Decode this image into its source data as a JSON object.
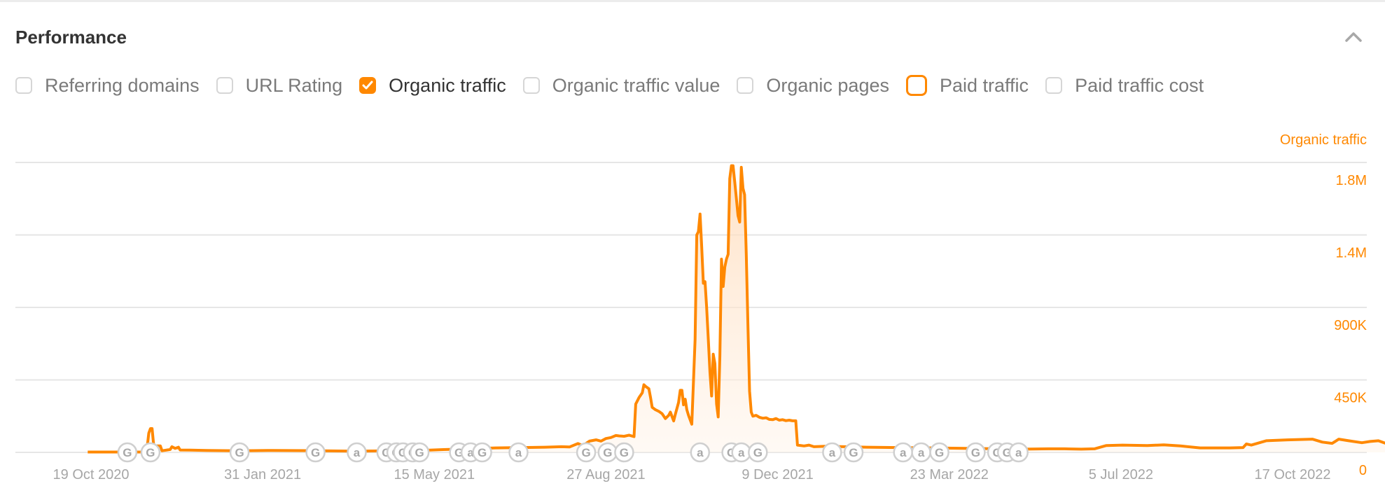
{
  "section": {
    "title": "Performance",
    "collapse_icon": "chevron-up-icon"
  },
  "metrics": [
    {
      "label": "Referring domains",
      "state": "unchecked"
    },
    {
      "label": "URL Rating",
      "state": "unchecked"
    },
    {
      "label": "Organic traffic",
      "state": "checked"
    },
    {
      "label": "Organic traffic value",
      "state": "unchecked"
    },
    {
      "label": "Organic pages",
      "state": "unchecked"
    },
    {
      "label": "Paid traffic",
      "state": "highlighted"
    },
    {
      "label": "Paid traffic cost",
      "state": "unchecked"
    }
  ],
  "colors": {
    "accent": "#ff8800",
    "area_fill": "#ffe7d1",
    "grid": "#e6e6e6",
    "muted_text": "#a6a6a6"
  },
  "chart_data": {
    "type": "area",
    "title": "",
    "series_name": "Organic traffic",
    "ylabel": "Organic traffic",
    "ylim": [
      0,
      1800000
    ],
    "yticks": [
      {
        "value": 1800000,
        "label": "1.8M"
      },
      {
        "value": 1350000,
        "label": "1.4M"
      },
      {
        "value": 900000,
        "label": "900K"
      },
      {
        "value": 450000,
        "label": "450K"
      },
      {
        "value": 0,
        "label": "0"
      }
    ],
    "x_start_date": "2020-10-19",
    "xlim_days": [
      -31,
      781
    ],
    "xticks": [
      {
        "day": 0,
        "label": "19 Oct 2020"
      },
      {
        "day": 104,
        "label": "31 Jan 2021"
      },
      {
        "day": 208,
        "label": "15 May 2021"
      },
      {
        "day": 312,
        "label": "27 Aug 2021"
      },
      {
        "day": 416,
        "label": "9 Dec 2021"
      },
      {
        "day": 520,
        "label": "23 Mar 2022"
      },
      {
        "day": 624,
        "label": "5 Jul 2022"
      },
      {
        "day": 728,
        "label": "17 Oct 2022"
      }
    ],
    "grid": true,
    "points_day_value": [
      [
        -2,
        2000
      ],
      [
        20,
        2000
      ],
      [
        30,
        2000
      ],
      [
        33,
        2000
      ],
      [
        34,
        30000
      ],
      [
        35,
        120000
      ],
      [
        36,
        148000
      ],
      [
        37,
        148000
      ],
      [
        38,
        40000
      ],
      [
        39,
        40000
      ],
      [
        40,
        40000
      ],
      [
        42,
        40000
      ],
      [
        43,
        10000
      ],
      [
        46,
        15000
      ],
      [
        48,
        18000
      ],
      [
        49,
        35000
      ],
      [
        51,
        25000
      ],
      [
        53,
        32000
      ],
      [
        54,
        15000
      ],
      [
        60,
        14000
      ],
      [
        70,
        12000
      ],
      [
        90,
        10000
      ],
      [
        110,
        12000
      ],
      [
        130,
        11000
      ],
      [
        160,
        8000
      ],
      [
        180,
        10000
      ],
      [
        200,
        12000
      ],
      [
        215,
        18000
      ],
      [
        230,
        22000
      ],
      [
        245,
        28000
      ],
      [
        260,
        30000
      ],
      [
        275,
        32000
      ],
      [
        285,
        35000
      ],
      [
        290,
        34000
      ],
      [
        295,
        55000
      ],
      [
        298,
        42000
      ],
      [
        302,
        70000
      ],
      [
        306,
        78000
      ],
      [
        309,
        70000
      ],
      [
        312,
        86000
      ],
      [
        315,
        92000
      ],
      [
        318,
        105000
      ],
      [
        320,
        102000
      ],
      [
        323,
        100000
      ],
      [
        326,
        107000
      ],
      [
        329,
        98000
      ],
      [
        330,
        300000
      ],
      [
        332,
        340000
      ],
      [
        334,
        370000
      ],
      [
        335,
        420000
      ],
      [
        336,
        410000
      ],
      [
        338,
        395000
      ],
      [
        339,
        340000
      ],
      [
        340,
        280000
      ],
      [
        342,
        265000
      ],
      [
        344,
        255000
      ],
      [
        346,
        240000
      ],
      [
        348,
        210000
      ],
      [
        350,
        230000
      ],
      [
        351,
        250000
      ],
      [
        353,
        195000
      ],
      [
        354,
        235000
      ],
      [
        356,
        310000
      ],
      [
        357,
        385000
      ],
      [
        358,
        385000
      ],
      [
        359,
        295000
      ],
      [
        360,
        330000
      ],
      [
        361,
        265000
      ],
      [
        362,
        230000
      ],
      [
        364,
        175000
      ],
      [
        366,
        700000
      ],
      [
        367,
        1350000
      ],
      [
        368,
        1370000
      ],
      [
        369,
        1480000
      ],
      [
        370,
        1280000
      ],
      [
        371,
        1050000
      ],
      [
        372,
        1060000
      ],
      [
        373,
        900000
      ],
      [
        374,
        700000
      ],
      [
        375,
        500000
      ],
      [
        376,
        350000
      ],
      [
        377,
        610000
      ],
      [
        378,
        550000
      ],
      [
        379,
        300000
      ],
      [
        380,
        220000
      ],
      [
        381,
        600000
      ],
      [
        382,
        1200000
      ],
      [
        383,
        1030000
      ],
      [
        384,
        1150000
      ],
      [
        385,
        1200000
      ],
      [
        386,
        1230000
      ],
      [
        387,
        1700000
      ],
      [
        388,
        1780000
      ],
      [
        389,
        1780000
      ],
      [
        390,
        1680000
      ],
      [
        391,
        1580000
      ],
      [
        392,
        1470000
      ],
      [
        393,
        1430000
      ],
      [
        394,
        1770000
      ],
      [
        395,
        1640000
      ],
      [
        396,
        1600000
      ],
      [
        397,
        1230000
      ],
      [
        398,
        800000
      ],
      [
        399,
        380000
      ],
      [
        400,
        250000
      ],
      [
        401,
        225000
      ],
      [
        403,
        230000
      ],
      [
        405,
        218000
      ],
      [
        407,
        212000
      ],
      [
        409,
        215000
      ],
      [
        411,
        205000
      ],
      [
        413,
        203000
      ],
      [
        415,
        210000
      ],
      [
        417,
        200000
      ],
      [
        419,
        203000
      ],
      [
        421,
        197000
      ],
      [
        423,
        200000
      ],
      [
        425,
        196000
      ],
      [
        427,
        196000
      ],
      [
        428,
        45000
      ],
      [
        432,
        40000
      ],
      [
        435,
        45000
      ],
      [
        438,
        35000
      ],
      [
        445,
        38000
      ],
      [
        470,
        32000
      ],
      [
        490,
        30000
      ],
      [
        510,
        28000
      ],
      [
        530,
        25000
      ],
      [
        550,
        22000
      ],
      [
        565,
        20000
      ],
      [
        580,
        22000
      ],
      [
        590,
        22000
      ],
      [
        600,
        20000
      ],
      [
        608,
        22000
      ],
      [
        615,
        42000
      ],
      [
        625,
        45000
      ],
      [
        640,
        42000
      ],
      [
        650,
        47000
      ],
      [
        660,
        40000
      ],
      [
        672,
        28000
      ],
      [
        690,
        28000
      ],
      [
        698,
        30000
      ],
      [
        700,
        52000
      ],
      [
        703,
        45000
      ],
      [
        712,
        72000
      ],
      [
        725,
        78000
      ],
      [
        740,
        82000
      ],
      [
        746,
        64000
      ],
      [
        752,
        56000
      ],
      [
        756,
        82000
      ],
      [
        762,
        72000
      ],
      [
        770,
        60000
      ],
      [
        775,
        68000
      ],
      [
        780,
        72000
      ],
      [
        784,
        58000
      ],
      [
        788,
        62000
      ]
    ],
    "annotations": [
      {
        "day": 22,
        "type": "G"
      },
      {
        "day": 36,
        "type": "G"
      },
      {
        "day": 90,
        "type": "G"
      },
      {
        "day": 136,
        "type": "G"
      },
      {
        "day": 161,
        "type": "a"
      },
      {
        "day": 179,
        "type": "G"
      },
      {
        "day": 185,
        "type": "G"
      },
      {
        "day": 189,
        "type": "G"
      },
      {
        "day": 195,
        "type": "G"
      },
      {
        "day": 199,
        "type": "G"
      },
      {
        "day": 223,
        "type": "G"
      },
      {
        "day": 230,
        "type": "a"
      },
      {
        "day": 237,
        "type": "G"
      },
      {
        "day": 259,
        "type": "a"
      },
      {
        "day": 300,
        "type": "G"
      },
      {
        "day": 313,
        "type": "G"
      },
      {
        "day": 323,
        "type": "G"
      },
      {
        "day": 369,
        "type": "a"
      },
      {
        "day": 388,
        "type": "G"
      },
      {
        "day": 394,
        "type": "a"
      },
      {
        "day": 404,
        "type": "G"
      },
      {
        "day": 449,
        "type": "a"
      },
      {
        "day": 462,
        "type": "G"
      },
      {
        "day": 492,
        "type": "a"
      },
      {
        "day": 503,
        "type": "a"
      },
      {
        "day": 514,
        "type": "G"
      },
      {
        "day": 536,
        "type": "G"
      },
      {
        "day": 549,
        "type": "G"
      },
      {
        "day": 555,
        "type": "G"
      },
      {
        "day": 562,
        "type": "a"
      }
    ]
  }
}
